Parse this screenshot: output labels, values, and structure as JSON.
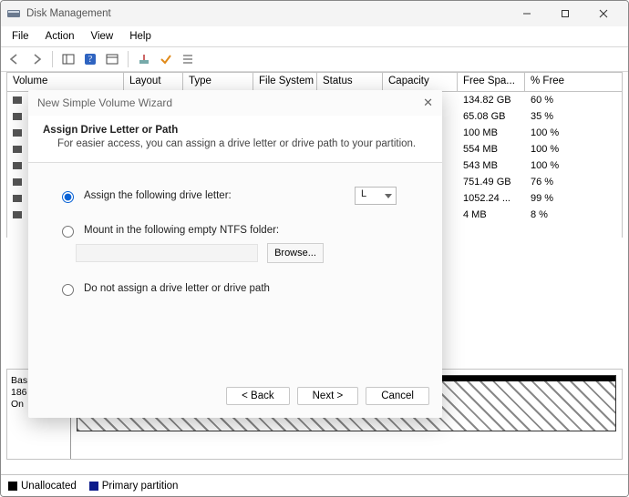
{
  "titlebar": {
    "app_name": "Disk Management"
  },
  "menus": {
    "file": "File",
    "action": "Action",
    "view": "View",
    "help": "Help"
  },
  "columns": {
    "volume": "Volume",
    "layout": "Layout",
    "type": "Type",
    "file_system": "File System",
    "status": "Status",
    "capacity": "Capacity",
    "free": "Free Spa...",
    "pct": "% Free"
  },
  "volumes": [
    {
      "free": "134.82 GB",
      "pct": "60 %"
    },
    {
      "free": "65.08 GB",
      "pct": "35 %"
    },
    {
      "free": "100 MB",
      "pct": "100 %"
    },
    {
      "free": "554 MB",
      "pct": "100 %"
    },
    {
      "free": "543 MB",
      "pct": "100 %"
    },
    {
      "free": "751.49 GB",
      "pct": "76 %"
    },
    {
      "free": "1052.24 ...",
      "pct": "99 %"
    },
    {
      "free": "4 MB",
      "pct": "8 %"
    }
  ],
  "disk": {
    "label": "Bas",
    "size": "186",
    "status": "On"
  },
  "legend": {
    "unallocated": "Unallocated",
    "primary": "Primary partition"
  },
  "wizard": {
    "title": "New Simple Volume Wizard",
    "heading": "Assign Drive Letter or Path",
    "subheading": "For easier access, you can assign a drive letter or drive path to your partition.",
    "opt_assign": "Assign the following drive letter:",
    "opt_mount": "Mount in the following empty NTFS folder:",
    "opt_none": "Do not assign a drive letter or drive path",
    "drive_letter": "L",
    "browse": "Browse...",
    "back": "< Back",
    "next": "Next >",
    "cancel": "Cancel"
  }
}
